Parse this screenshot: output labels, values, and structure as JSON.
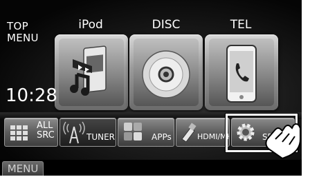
{
  "top_menu": {
    "line1": "TOP",
    "line2": "MENU"
  },
  "clock": "10:28",
  "sources": [
    {
      "label": "iPod",
      "icon": "ipod-music-icon"
    },
    {
      "label": "DISC",
      "icon": "disc-icon"
    },
    {
      "label": "TEL",
      "icon": "phone-icon"
    }
  ],
  "bottom_buttons": [
    {
      "line1": "ALL",
      "line2": "SRC",
      "icon": "all-sources-grid-icon"
    },
    {
      "label": "TUNER",
      "icon": "tuner-antenna-icon"
    },
    {
      "label": "APPs",
      "icon": "apps-icon"
    },
    {
      "label": "HDMI/MH",
      "icon": "hdmi-cable-icon"
    },
    {
      "label": "SETU",
      "icon": "setup-gear-icon"
    }
  ],
  "menu_tab": "MENU",
  "highlight_color": "#ffffff",
  "pointer": "hand-pointer-icon"
}
